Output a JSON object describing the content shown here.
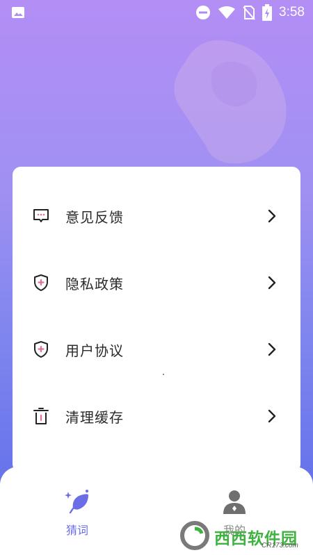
{
  "status_bar": {
    "time": "3:58",
    "icons": [
      "image-icon",
      "do-not-disturb-icon",
      "wifi-icon",
      "no-sim-icon",
      "battery-charging-icon"
    ]
  },
  "menu": {
    "items": [
      {
        "label": "意见反馈",
        "icon": "feedback-icon"
      },
      {
        "label": "隐私政策",
        "icon": "privacy-shield-icon"
      },
      {
        "label": "用户协议",
        "icon": "agreement-shield-icon"
      },
      {
        "label": "清理缓存",
        "icon": "trash-icon"
      }
    ]
  },
  "bottom_nav": {
    "tabs": [
      {
        "label": "猜词",
        "icon": "sparkle-leaf-icon",
        "active": true
      },
      {
        "label": "我的",
        "icon": "user-icon",
        "active": false
      }
    ]
  },
  "watermark": {
    "text": "西西软件园",
    "sub": "CR173.com"
  },
  "colors": {
    "accent": "#6b6ee6",
    "gradient_top": "#b38ef5",
    "gradient_bottom": "#5a6ae8"
  }
}
